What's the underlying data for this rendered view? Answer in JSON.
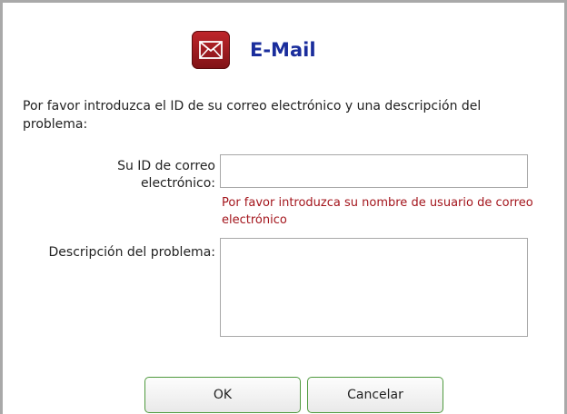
{
  "dialog": {
    "title": "E-Mail",
    "icon": "envelope-icon",
    "accent_color": "#1a2d9c",
    "icon_color": "#b01e24"
  },
  "form": {
    "intro": "Por favor introduzca el ID de su correo electrónico y una descripción del problema:",
    "email_id_label": "Su ID de correo electrónico:",
    "email_id_value": "",
    "email_id_error": "Por favor introduzca su nombre de usuario de correo electrónico",
    "error_color": "#a3151c",
    "description_label": "Descripción del problema:",
    "description_value": ""
  },
  "buttons": {
    "ok_label": "OK",
    "cancel_label": "Cancelar",
    "border_color": "#4f9a3e"
  }
}
